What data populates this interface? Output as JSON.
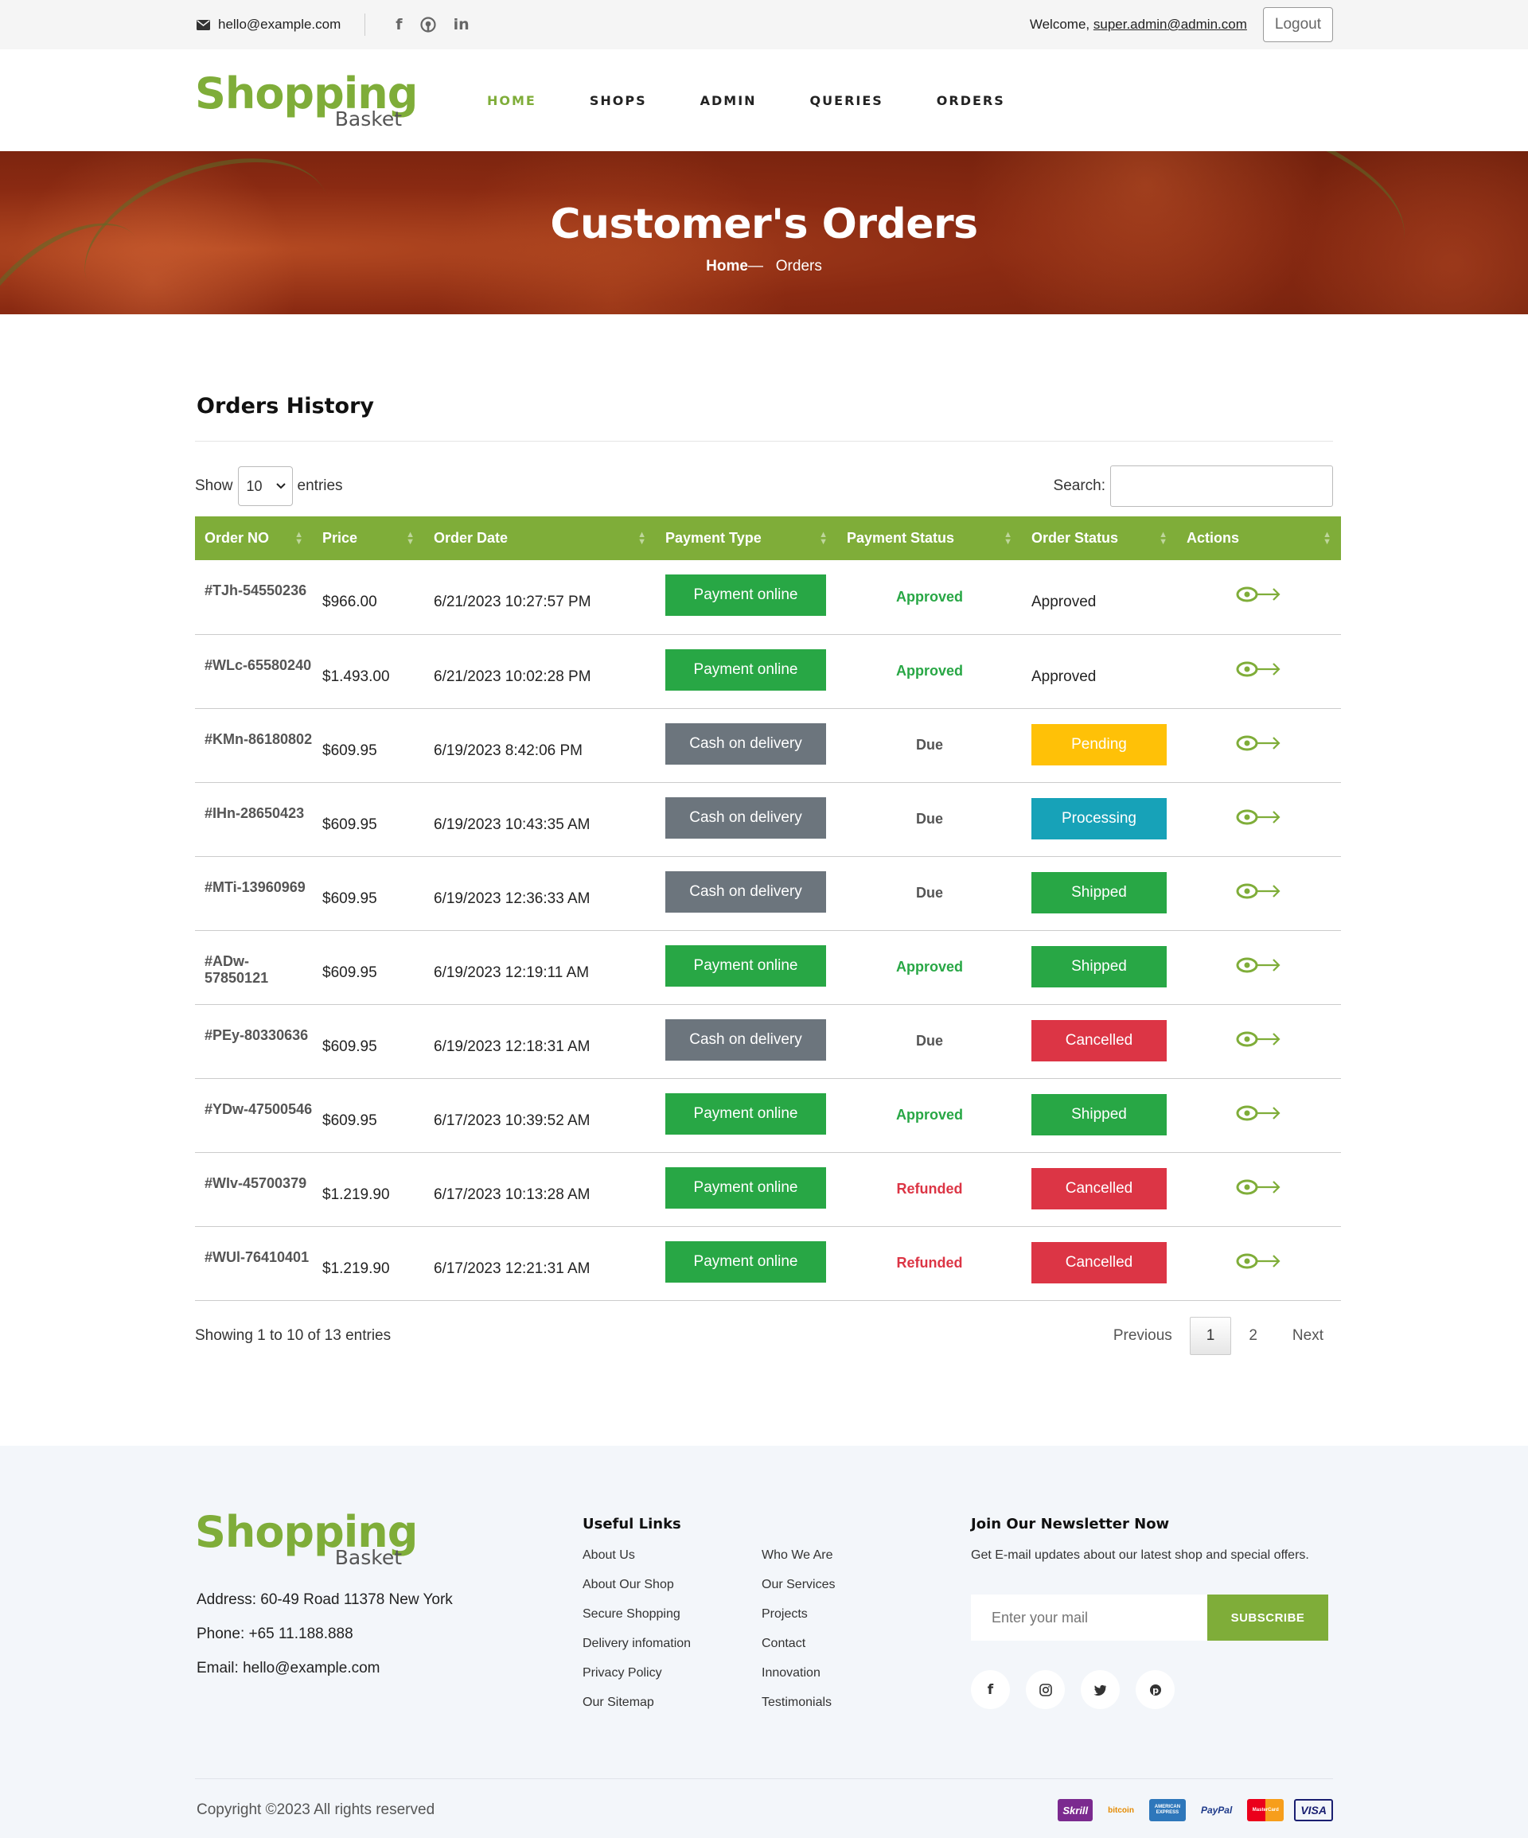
{
  "topbar": {
    "email": "hello@example.com",
    "welcome": "Welcome,",
    "user": "super.admin@admin.com",
    "logout": "Logout"
  },
  "logo": {
    "line1": "Shopping",
    "line2": "Basket"
  },
  "nav": {
    "home": "HOME",
    "shops": "SHOPS",
    "admin": "ADMIN",
    "queries": "QUERIES",
    "orders": "ORDERS"
  },
  "hero": {
    "title": "Customer's Orders",
    "crumb_home": "Home",
    "crumb_sep": "—",
    "crumb_current": "Orders"
  },
  "orders": {
    "heading": "Orders History",
    "show": "Show",
    "page_size": "10",
    "entries": "entries",
    "search_label": "Search:",
    "columns": [
      "Order NO",
      "Price",
      "Order Date",
      "Payment Type",
      "Payment Status",
      "Order Status",
      "Actions"
    ],
    "rows": [
      {
        "no": "#TJh-54550236",
        "price": "$966.00",
        "date": "6/21/2023 10:27:57 PM",
        "ptype": "Payment online",
        "pstat": "Approved",
        "ostat": "Approved"
      },
      {
        "no": "#WLc-65580240",
        "price": "$1.493.00",
        "date": "6/21/2023 10:02:28 PM",
        "ptype": "Payment online",
        "pstat": "Approved",
        "ostat": "Approved"
      },
      {
        "no": "#KMn-86180802",
        "price": "$609.95",
        "date": "6/19/2023 8:42:06 PM",
        "ptype": "Cash on delivery",
        "pstat": "Due",
        "ostat": "Pending"
      },
      {
        "no": "#IHn-28650423",
        "price": "$609.95",
        "date": "6/19/2023 10:43:35 AM",
        "ptype": "Cash on delivery",
        "pstat": "Due",
        "ostat": "Processing"
      },
      {
        "no": "#MTi-13960969",
        "price": "$609.95",
        "date": "6/19/2023 12:36:33 AM",
        "ptype": "Cash on delivery",
        "pstat": "Due",
        "ostat": "Shipped"
      },
      {
        "no": "#ADw-57850121",
        "price": "$609.95",
        "date": "6/19/2023 12:19:11 AM",
        "ptype": "Payment online",
        "pstat": "Approved",
        "ostat": "Shipped"
      },
      {
        "no": "#PEy-80330636",
        "price": "$609.95",
        "date": "6/19/2023 12:18:31 AM",
        "ptype": "Cash on delivery",
        "pstat": "Due",
        "ostat": "Cancelled"
      },
      {
        "no": "#YDw-47500546",
        "price": "$609.95",
        "date": "6/17/2023 10:39:52 AM",
        "ptype": "Payment online",
        "pstat": "Approved",
        "ostat": "Shipped"
      },
      {
        "no": "#WIv-45700379",
        "price": "$1.219.90",
        "date": "6/17/2023 10:13:28 AM",
        "ptype": "Payment online",
        "pstat": "Refunded",
        "ostat": "Cancelled"
      },
      {
        "no": "#WUl-76410401",
        "price": "$1.219.90",
        "date": "6/17/2023 12:21:31 AM",
        "ptype": "Payment online",
        "pstat": "Refunded",
        "ostat": "Cancelled"
      }
    ],
    "info": "Showing 1 to 10 of 13 entries",
    "pager": {
      "prev": "Previous",
      "page1": "1",
      "page2": "2",
      "next": "Next"
    }
  },
  "footer": {
    "address": "Address: 60-49 Road 11378 New York",
    "phone": "Phone: +65 11.188.888",
    "email": "Email: hello@example.com",
    "useful_title": "Useful Links",
    "links": [
      "About Us",
      "Who We Are",
      "About Our Shop",
      "Our Services",
      "Secure Shopping",
      "Projects",
      "Delivery infomation",
      "Contact",
      "Privacy Policy",
      "Innovation",
      "Our Sitemap",
      "Testimonials"
    ],
    "newsletter_title": "Join Our Newsletter Now",
    "newsletter_text": "Get E-mail updates about our latest shop and special offers.",
    "newsletter_placeholder": "Enter your mail",
    "subscribe": "SUBSCRIBE",
    "copyright": "Copyright ©2023 All rights reserved",
    "payment_cards": [
      "Skrill",
      "bitcoin",
      "AMERICAN EXPRESS",
      "PayPal",
      "MasterCard",
      "VISA"
    ]
  },
  "colors": {
    "brand": "#7fad39",
    "success": "#28a745",
    "secondary": "#6c757d",
    "warning": "#ffc107",
    "info": "#17a2b8",
    "danger": "#dc3545"
  }
}
